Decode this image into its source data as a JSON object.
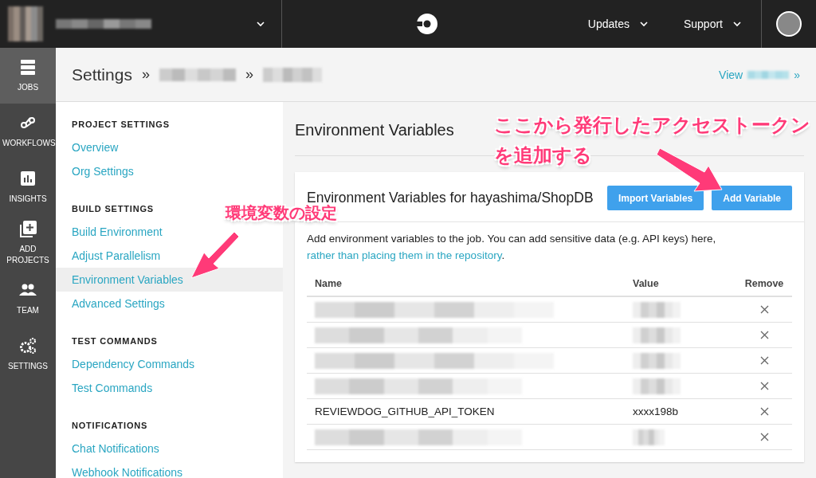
{
  "topbar": {
    "nav": [
      {
        "label": "Updates"
      },
      {
        "label": "Support"
      }
    ]
  },
  "rail": [
    {
      "label": "JOBS",
      "selected": true
    },
    {
      "label": "WORKFLOWS",
      "selected": false
    },
    {
      "label": "INSIGHTS",
      "selected": false
    },
    {
      "label": "ADD PROJECTS",
      "selected": false
    },
    {
      "label": "TEAM",
      "selected": false
    },
    {
      "label": "SETTINGS",
      "selected": false
    }
  ],
  "header": {
    "title": "Settings",
    "separators": [
      "»",
      "»"
    ],
    "view_link": "View",
    "view_suffix": "»"
  },
  "menu": [
    {
      "heading": "PROJECT SETTINGS",
      "items": [
        {
          "label": "Overview",
          "selected": false
        },
        {
          "label": "Org Settings",
          "selected": false
        }
      ]
    },
    {
      "heading": "BUILD SETTINGS",
      "items": [
        {
          "label": "Build Environment",
          "selected": false
        },
        {
          "label": "Adjust Parallelism",
          "selected": false
        },
        {
          "label": "Environment Variables",
          "selected": true
        },
        {
          "label": "Advanced Settings",
          "selected": false
        }
      ]
    },
    {
      "heading": "TEST COMMANDS",
      "items": [
        {
          "label": "Dependency Commands",
          "selected": false
        },
        {
          "label": "Test Commands",
          "selected": false
        }
      ]
    },
    {
      "heading": "NOTIFICATIONS",
      "items": [
        {
          "label": "Chat Notifications",
          "selected": false
        },
        {
          "label": "Webhook Notifications",
          "selected": false
        }
      ]
    }
  ],
  "main": {
    "title": "Environment Variables",
    "card_title": "Environment Variables for hayashima/ShopDB",
    "buttons": [
      {
        "label": "Import Variables"
      },
      {
        "label": "Add Variable"
      }
    ],
    "description": "Add environment variables to the job. You can add sensitive data (e.g. API keys) here, ",
    "description_link": "rather than placing them in the repository",
    "description_end": ".",
    "columns": [
      "Name",
      "Value",
      "Remove"
    ],
    "rows": [
      {
        "kind": "redacted"
      },
      {
        "kind": "redacted"
      },
      {
        "kind": "redacted"
      },
      {
        "kind": "redacted"
      },
      {
        "kind": "text",
        "name": "REVIEWDOG_GITHUB_API_TOKEN",
        "value": "xxxx198b"
      },
      {
        "kind": "redacted"
      }
    ]
  },
  "annotations": [
    {
      "lines": [
        "環境変数の設定"
      ]
    },
    {
      "lines": [
        "ここから発行したアクセストークン",
        "を追加する"
      ]
    }
  ]
}
